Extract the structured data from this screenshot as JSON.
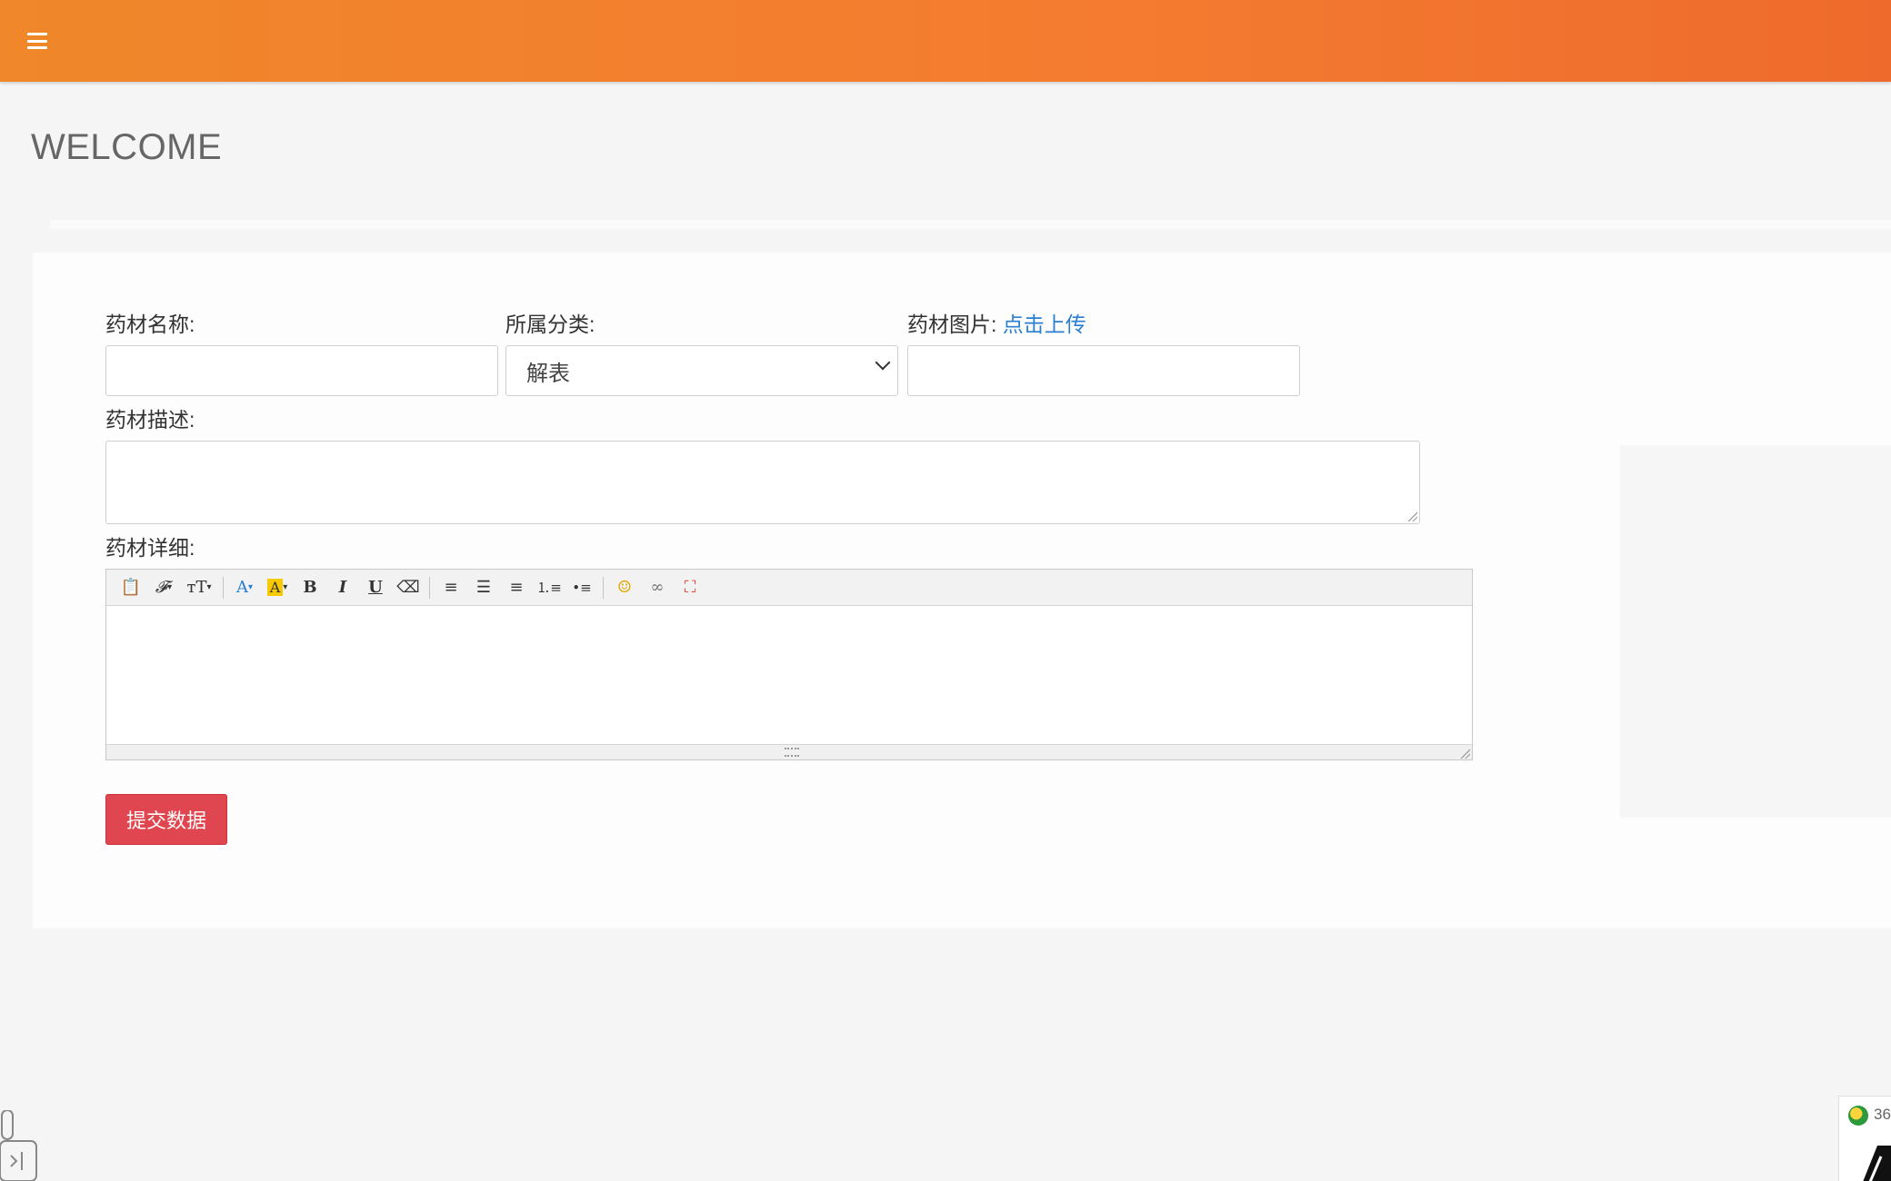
{
  "header": {
    "menu_icon": "hamburger-menu-icon",
    "brand_color": "#f47b30"
  },
  "page": {
    "title": "WELCOME"
  },
  "form": {
    "name_label": "药材名称:",
    "name_value": "",
    "category_label": "所属分类:",
    "category_selected": "解表",
    "image_label": "药材图片:",
    "image_upload_link": "点击上传",
    "image_value": "",
    "description_label": "药材描述:",
    "description_value": "",
    "detail_label": "药材详细:",
    "submit_label": "提交数据",
    "submit_color": "#e0464f"
  },
  "editor": {
    "toolbar_icons": [
      "paste-icon",
      "font-family-icon",
      "font-size-icon",
      "font-color-icon",
      "highlight-color-icon",
      "bold-icon",
      "italic-icon",
      "underline-icon",
      "clear-format-icon",
      "align-left-icon",
      "align-center-icon",
      "align-right-icon",
      "ordered-list-icon",
      "unordered-list-icon",
      "emoji-icon",
      "link-icon",
      "fullscreen-icon"
    ]
  },
  "tray": {
    "badge_text": "36"
  }
}
